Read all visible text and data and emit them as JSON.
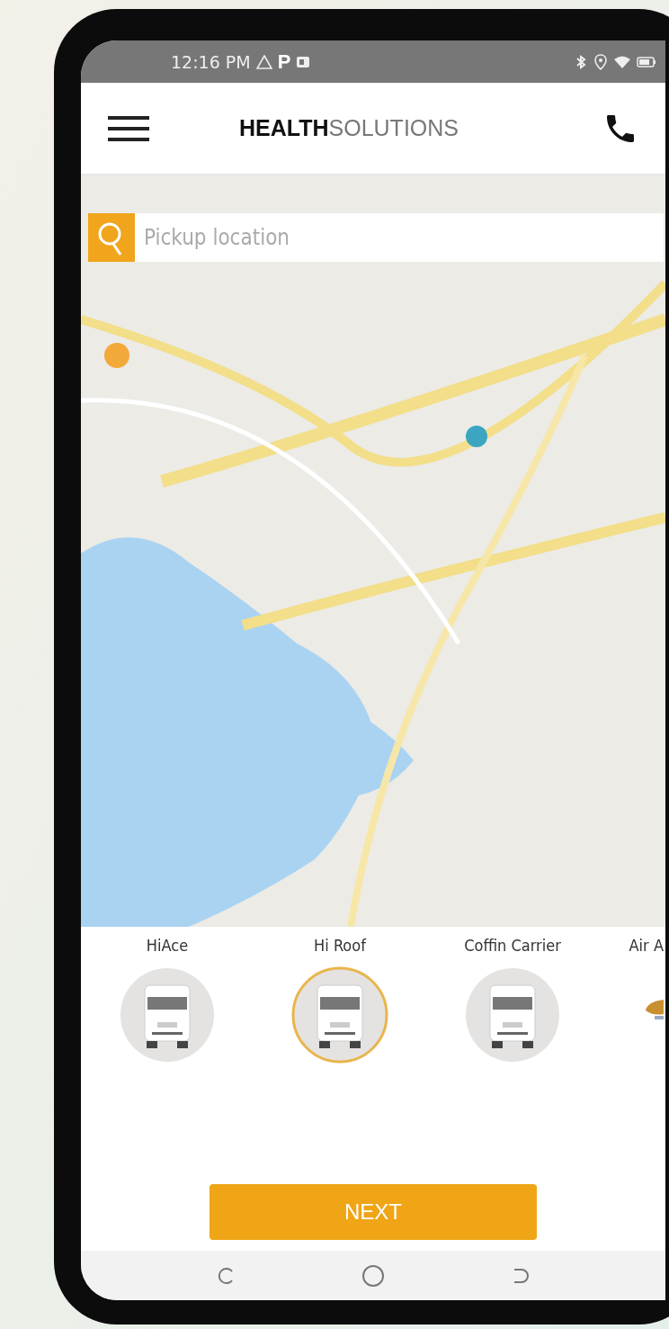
{
  "status_bar": {
    "time": "12:16 PM",
    "notification_glyph": "P"
  },
  "header": {
    "brand": "**HEALTH**SOLUTIONS"
  },
  "search": {
    "placeholder": "Pickup location"
  },
  "vehicles": [
    {
      "label": "HiAce",
      "selected": false,
      "kind": "van"
    },
    {
      "label": "Hi Roof",
      "selected": true,
      "kind": "van"
    },
    {
      "label": "Coffin Carrier",
      "selected": false,
      "kind": "van"
    },
    {
      "label": "Air A",
      "selected": false,
      "kind": "partial"
    }
  ],
  "next_button": {
    "label": "NEXT"
  }
}
